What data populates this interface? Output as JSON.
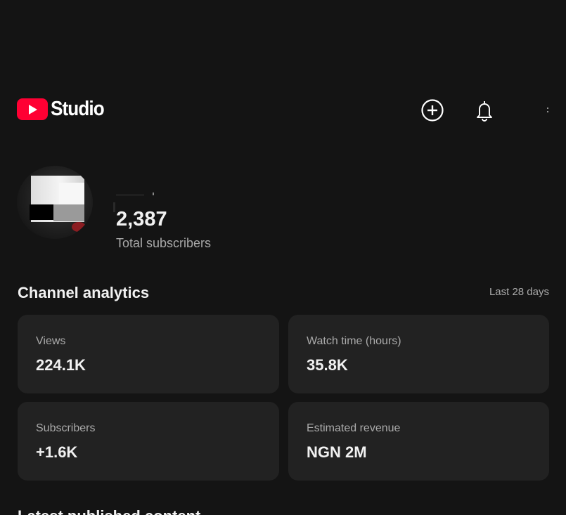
{
  "header": {
    "logo_text": "Studio",
    "icons": [
      "create-icon",
      "notifications-icon",
      "more-vertical-icon"
    ]
  },
  "channel": {
    "subscriber_count": "2,387",
    "subscriber_label": "Total subscribers"
  },
  "analytics": {
    "title": "Channel analytics",
    "range": "Last 28 days",
    "cards": [
      {
        "label": "Views",
        "value": "224.1K"
      },
      {
        "label": "Watch time (hours)",
        "value": "35.8K"
      },
      {
        "label": "Subscribers",
        "value": "+1.6K"
      },
      {
        "label": "Estimated revenue",
        "value": "NGN 2M"
      }
    ]
  },
  "next_section": {
    "title": "Latest published content"
  },
  "colors": {
    "background": "#141414",
    "card": "#222222",
    "brand_red": "#ff0033",
    "secondary_text": "#aaaaaa"
  }
}
